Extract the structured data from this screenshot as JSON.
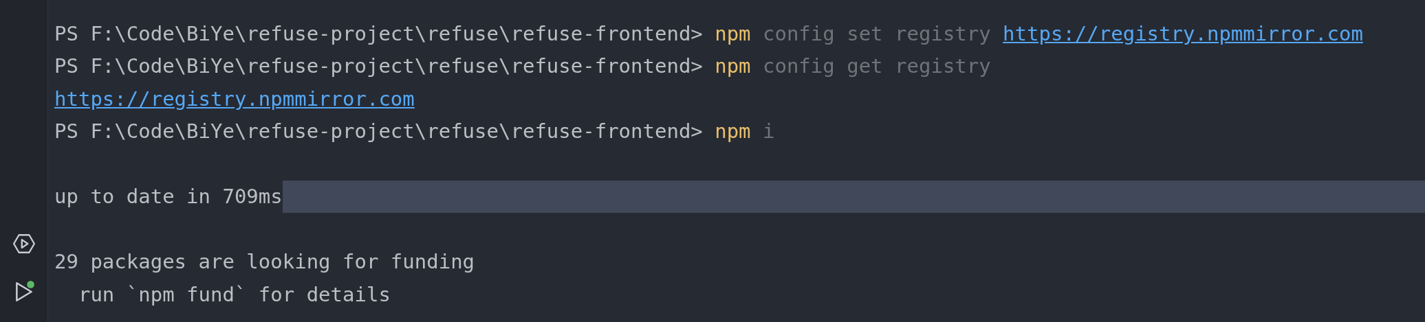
{
  "terminal": {
    "lines": [
      {
        "kind": "output",
        "highlighted": false,
        "segments": [
          {
            "kind": "prompt",
            "text": "PS F:\\Code\\BiYe\\refuse-project\\refuse\\refuse-frontend>"
          },
          {
            "kind": "command",
            "text": "npm"
          },
          {
            "kind": "argument",
            "text": "config set registry"
          },
          {
            "kind": "link",
            "text": "https://registry.npmmirror.com"
          }
        ]
      },
      {
        "kind": "output",
        "highlighted": false,
        "segments": [
          {
            "kind": "prompt",
            "text": "PS F:\\Code\\BiYe\\refuse-project\\refuse\\refuse-frontend>"
          },
          {
            "kind": "command",
            "text": "npm"
          },
          {
            "kind": "argument",
            "text": "config get registry"
          }
        ]
      },
      {
        "kind": "output",
        "highlighted": false,
        "segments": [
          {
            "kind": "link",
            "text": "https://registry.npmmirror.com"
          }
        ]
      },
      {
        "kind": "output",
        "highlighted": false,
        "segments": [
          {
            "kind": "prompt",
            "text": "PS F:\\Code\\BiYe\\refuse-project\\refuse\\refuse-frontend>"
          },
          {
            "kind": "command",
            "text": "npm"
          },
          {
            "kind": "argument",
            "text": "i"
          }
        ]
      },
      {
        "kind": "blank"
      },
      {
        "kind": "output",
        "highlighted": true,
        "segments": [
          {
            "kind": "output",
            "text": "up to date in 709ms"
          }
        ]
      },
      {
        "kind": "blank"
      },
      {
        "kind": "output",
        "highlighted": false,
        "segments": [
          {
            "kind": "output",
            "text": "29 packages are looking for funding"
          }
        ]
      },
      {
        "kind": "output",
        "highlighted": false,
        "segments": [
          {
            "kind": "output",
            "text": "  run `npm fund` for details"
          }
        ]
      }
    ]
  }
}
